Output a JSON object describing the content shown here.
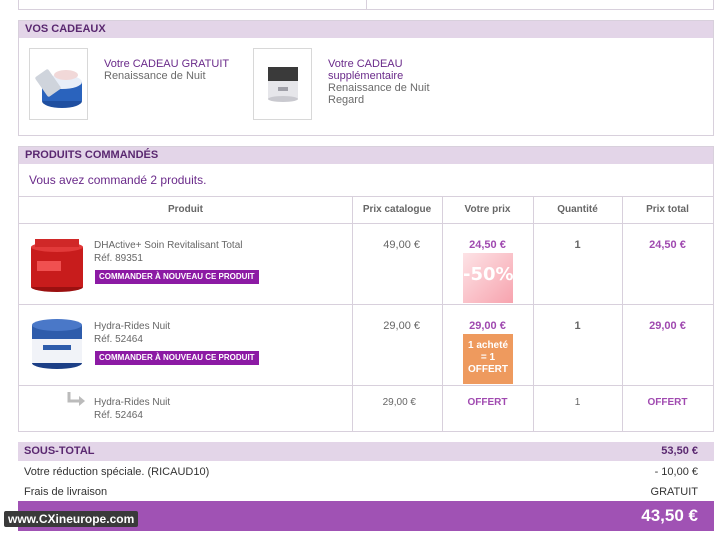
{
  "gifts": {
    "title": "VOS CADEAUX",
    "items": [
      {
        "title": "Votre CADEAU GRATUIT",
        "sub1": "Renaissance de Nuit",
        "sub2": ""
      },
      {
        "title": "Votre CADEAU supplémentaire",
        "sub1": "Renaissance de Nuit",
        "sub2": "Regard"
      }
    ]
  },
  "products": {
    "title": "PRODUITS COMMANDÉS",
    "summary": "Vous avez commandé 2 produits.",
    "columns": [
      "Produit",
      "Prix catalogue",
      "Votre prix",
      "Quantité",
      "Prix total"
    ],
    "reorder_label": "COMMANDER À NOUVEAU CE PRODUIT",
    "rows": [
      {
        "name": "DHActive+ Soin Revitalisant Total",
        "ref": "Réf. 89351",
        "catalogue": "49,00 €",
        "price": "24,50 €",
        "badge": "-50%",
        "qty": "1",
        "total": "24,50 €"
      },
      {
        "name": "Hydra-Rides Nuit",
        "ref": "Réf. 52464",
        "catalogue": "29,00 €",
        "price": "29,00 €",
        "badge_lines": [
          "1 acheté",
          "= 1",
          "OFFERT"
        ],
        "qty": "1",
        "total": "29,00 €"
      },
      {
        "name": "Hydra-Rides Nuit",
        "ref": "Réf. 52464",
        "catalogue": "29,00 €",
        "price": "OFFERT",
        "qty": "1",
        "total": "OFFERT"
      }
    ]
  },
  "totals": {
    "subtotal_label": "SOUS-TOTAL",
    "subtotal_value": "53,50 €",
    "discount_label": "Votre réduction spéciale. (RICAUD10)",
    "discount_value": "- 10,00 €",
    "shipping_label": "Frais de livraison",
    "shipping_value": "GRATUIT",
    "total_label": "TOTAL",
    "total_value": "43,50 €"
  },
  "watermark": "www.CXineurope.com",
  "colors": {
    "header_bg": "#e3d5e8",
    "accent_purple": "#8c1aa4",
    "total_bar": "#a052b4",
    "discount_badge": "#f7a3ae",
    "offer_badge": "#ee9a5e"
  }
}
